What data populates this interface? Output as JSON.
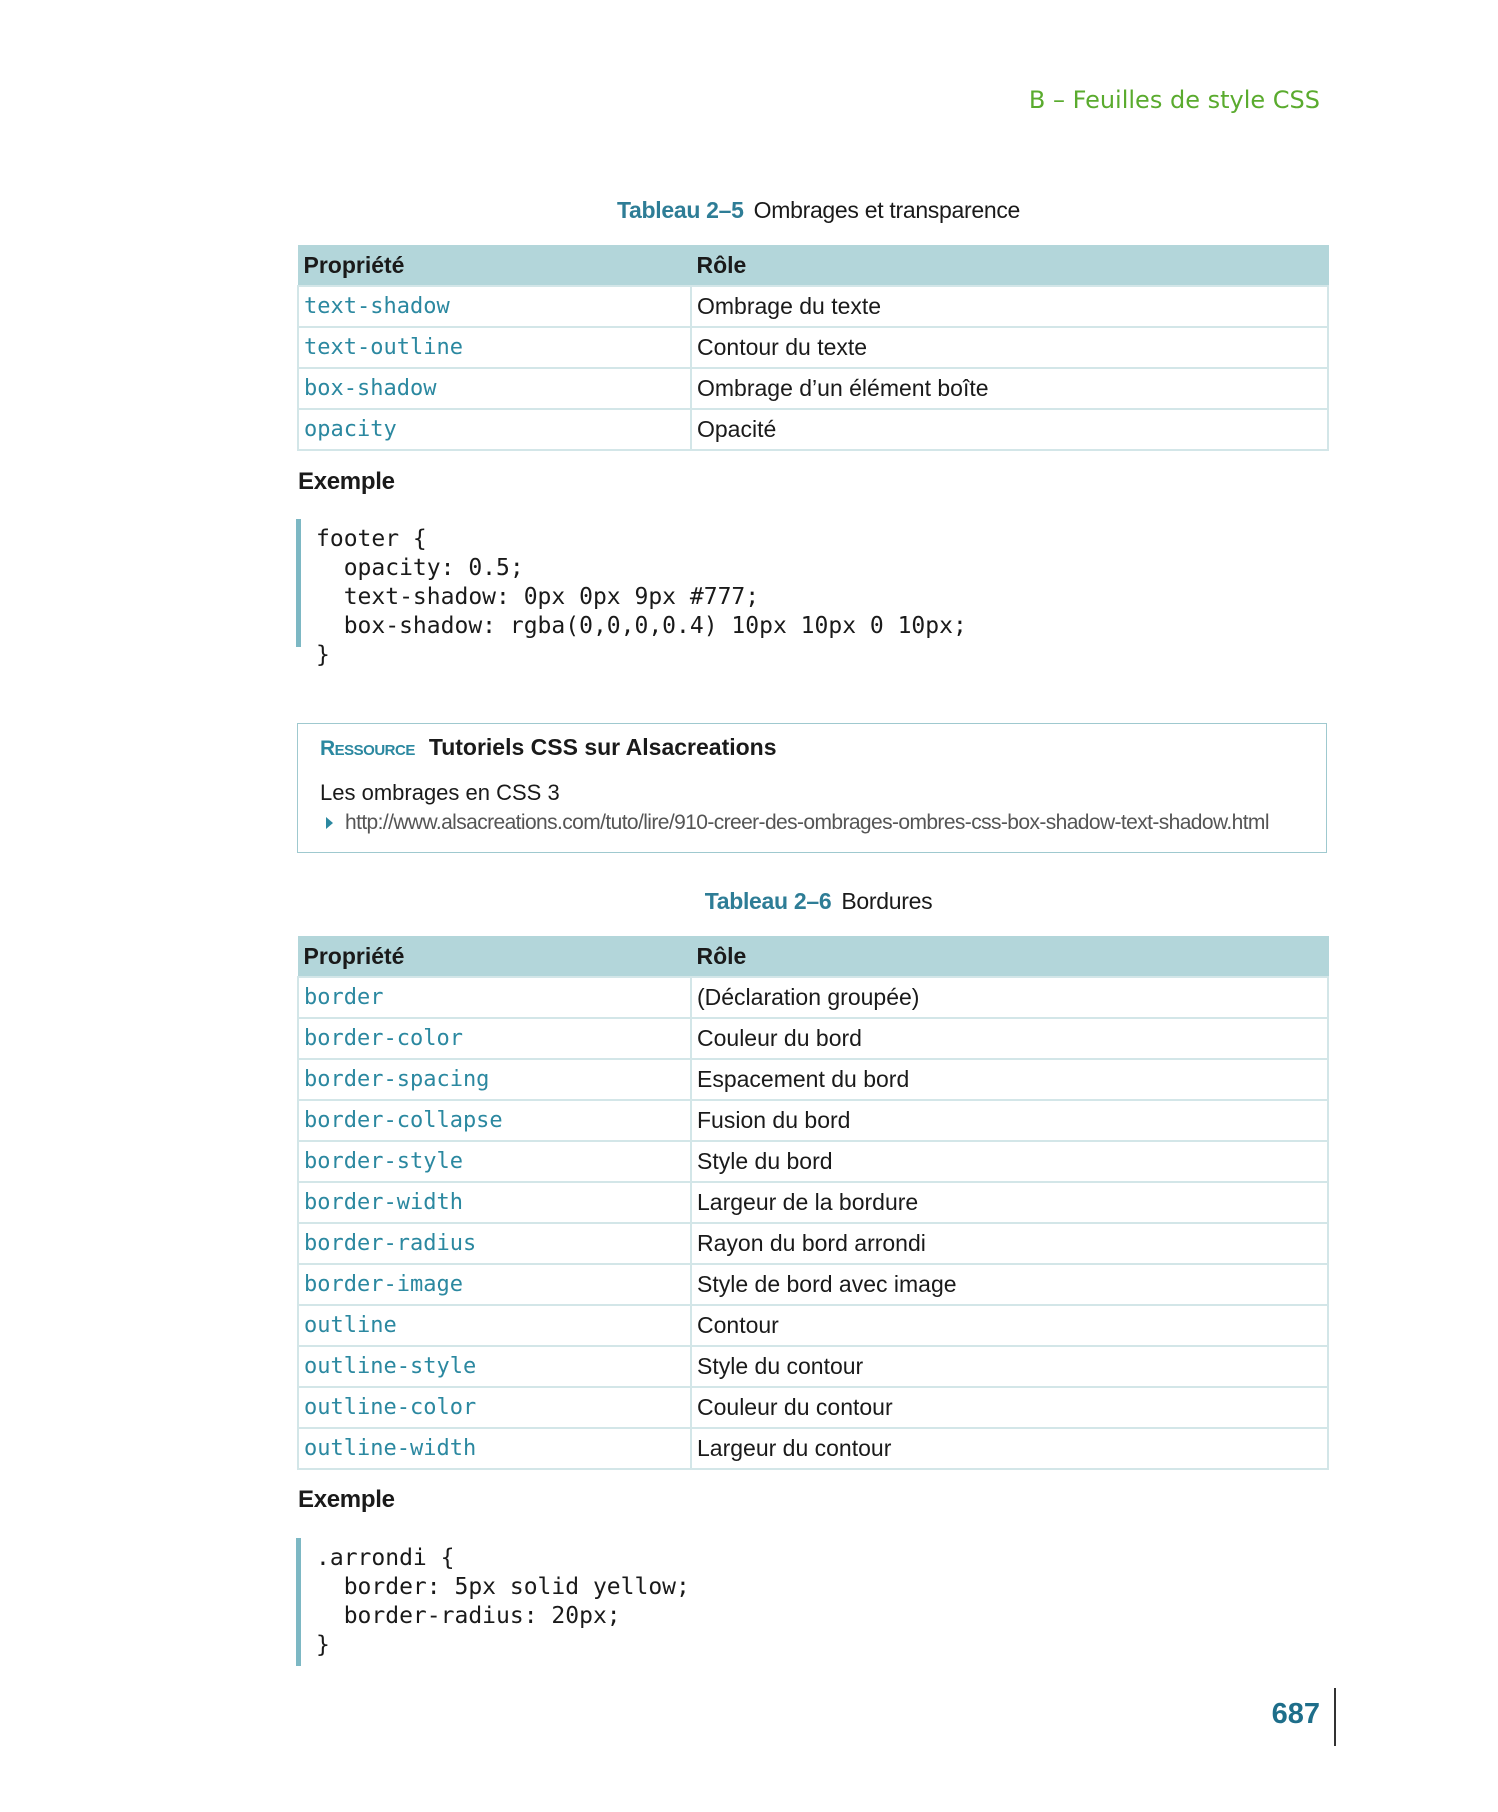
{
  "running_head": "B – Feuilles de style CSS",
  "table1": {
    "caption_num": "Tableau 2–5",
    "caption_text": "Ombrages et transparence",
    "headers": [
      "Propriété",
      "Rôle"
    ],
    "rows": [
      {
        "prop": "text-shadow",
        "role": "Ombrage du texte"
      },
      {
        "prop": "text-outline",
        "role": "Contour du texte"
      },
      {
        "prop": "box-shadow",
        "role": "Ombrage d’un élément boîte"
      },
      {
        "prop": "opacity",
        "role": "Opacité"
      }
    ]
  },
  "example1": {
    "title": "Exemple",
    "code": "footer {\n  opacity: 0.5;\n  text-shadow: 0px 0px 9px #777;\n  box-shadow: rgba(0,0,0,0.4) 10px 10px 0 10px;\n}"
  },
  "resource": {
    "label": "Ressource",
    "title": "Tutoriels CSS sur Alsacreations",
    "subtitle": "Les ombrages en CSS 3",
    "url": "http://www.alsacreations.com/tuto/lire/910-creer-des-ombrages-ombres-css-box-shadow-text-shadow.html",
    "icon": "triangle-right-icon"
  },
  "table2": {
    "caption_num": "Tableau 2–6",
    "caption_text": "Bordures",
    "headers": [
      "Propriété",
      "Rôle"
    ],
    "rows": [
      {
        "prop": "border",
        "role": "(Déclaration groupée)"
      },
      {
        "prop": "border-color",
        "role": "Couleur du bord"
      },
      {
        "prop": "border-spacing",
        "role": "Espacement du bord"
      },
      {
        "prop": "border-collapse",
        "role": "Fusion du bord"
      },
      {
        "prop": "border-style",
        "role": "Style du bord"
      },
      {
        "prop": "border-width",
        "role": "Largeur de la bordure"
      },
      {
        "prop": "border-radius",
        "role": "Rayon du bord arrondi"
      },
      {
        "prop": "border-image",
        "role": "Style de bord avec image"
      },
      {
        "prop": "outline",
        "role": "Contour"
      },
      {
        "prop": "outline-style",
        "role": "Style du contour"
      },
      {
        "prop": "outline-color",
        "role": "Couleur du contour"
      },
      {
        "prop": "outline-width",
        "role": "Largeur du contour"
      }
    ]
  },
  "example2": {
    "title": "Exemple",
    "code": ".arrondi {\n  border: 5px solid yellow;\n  border-radius: 20px;\n}"
  },
  "page_number": "687",
  "colors": {
    "accent_teal": "#2b88a0",
    "header_fill": "#b3d6da",
    "running_head_green": "#5aab2e"
  }
}
